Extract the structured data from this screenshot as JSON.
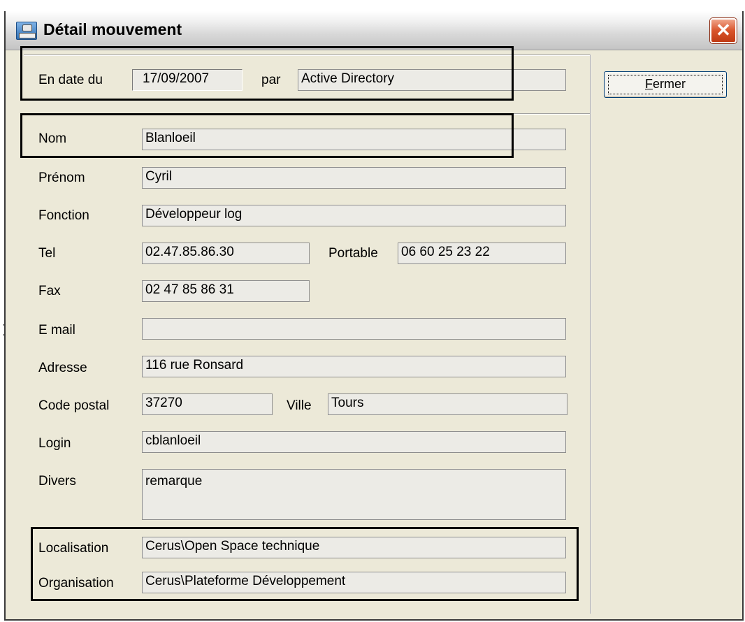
{
  "window": {
    "title": "Détail mouvement"
  },
  "buttons": {
    "close_symbol": "✕",
    "fermer_first": "F",
    "fermer_rest": "ermer"
  },
  "header": {
    "date_label": "En date du",
    "date_value": "17/09/2007",
    "par_label": "par",
    "par_value": "Active Directory"
  },
  "form": {
    "nom": {
      "label": "Nom",
      "value": "Blanloeil"
    },
    "prenom": {
      "label": "Prénom",
      "value": "Cyril"
    },
    "fonction": {
      "label": "Fonction",
      "value": "Développeur log"
    },
    "tel": {
      "label": "Tel",
      "value": "02.47.85.86.30"
    },
    "portable": {
      "label": "Portable",
      "value": "06 60 25 23 22"
    },
    "fax": {
      "label": "Fax",
      "value": "02 47 85 86 31"
    },
    "email": {
      "label": "E mail",
      "value": ""
    },
    "adresse": {
      "label": "Adresse",
      "value": "116 rue Ronsard"
    },
    "code_postal": {
      "label": "Code postal",
      "value": "37270"
    },
    "ville": {
      "label": "Ville",
      "value": "Tours"
    },
    "login": {
      "label": "Login",
      "value": "cblanloeil"
    },
    "divers": {
      "label": "Divers",
      "value": "remarque"
    },
    "localisation": {
      "label": "Localisation",
      "value": "Cerus\\Open Space technique"
    },
    "organisation": {
      "label": "Organisation",
      "value": "Cerus\\Plateforme Développement"
    }
  },
  "colors": {
    "dialog_bg": "#ece9d8",
    "field_bg": "#ecebe6",
    "close_button": "#d9542b",
    "highlight_border": "#000000"
  },
  "icons": {
    "app": "app-window-icon",
    "close": "close-icon",
    "pointer": "arrow-pointer-icon"
  }
}
